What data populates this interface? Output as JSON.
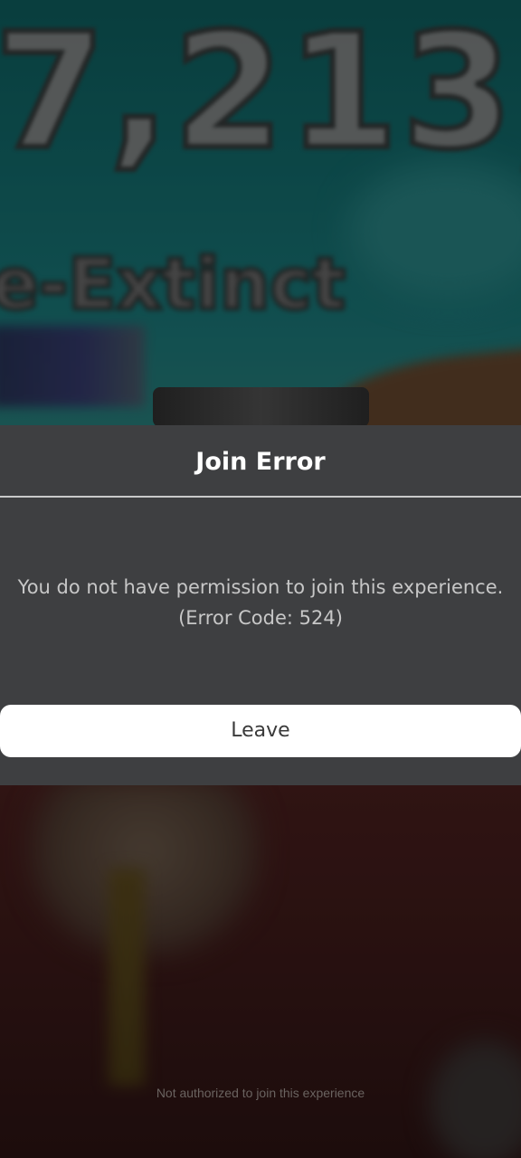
{
  "background": {
    "game_big_text": "7,213,",
    "game_sub_text": "e-Extinct"
  },
  "dialog": {
    "title": "Join Error",
    "message_line1": "You do not have permission to join this experience.",
    "message_line2": "(Error Code: 524)",
    "leave_label": "Leave"
  },
  "footer": {
    "note": "Not authorized to join this experience"
  },
  "colors": {
    "dialog_bg": "#3e3f41",
    "button_bg": "#ffffff",
    "title_text": "#ffffff",
    "message_text": "#c7c7c7"
  }
}
